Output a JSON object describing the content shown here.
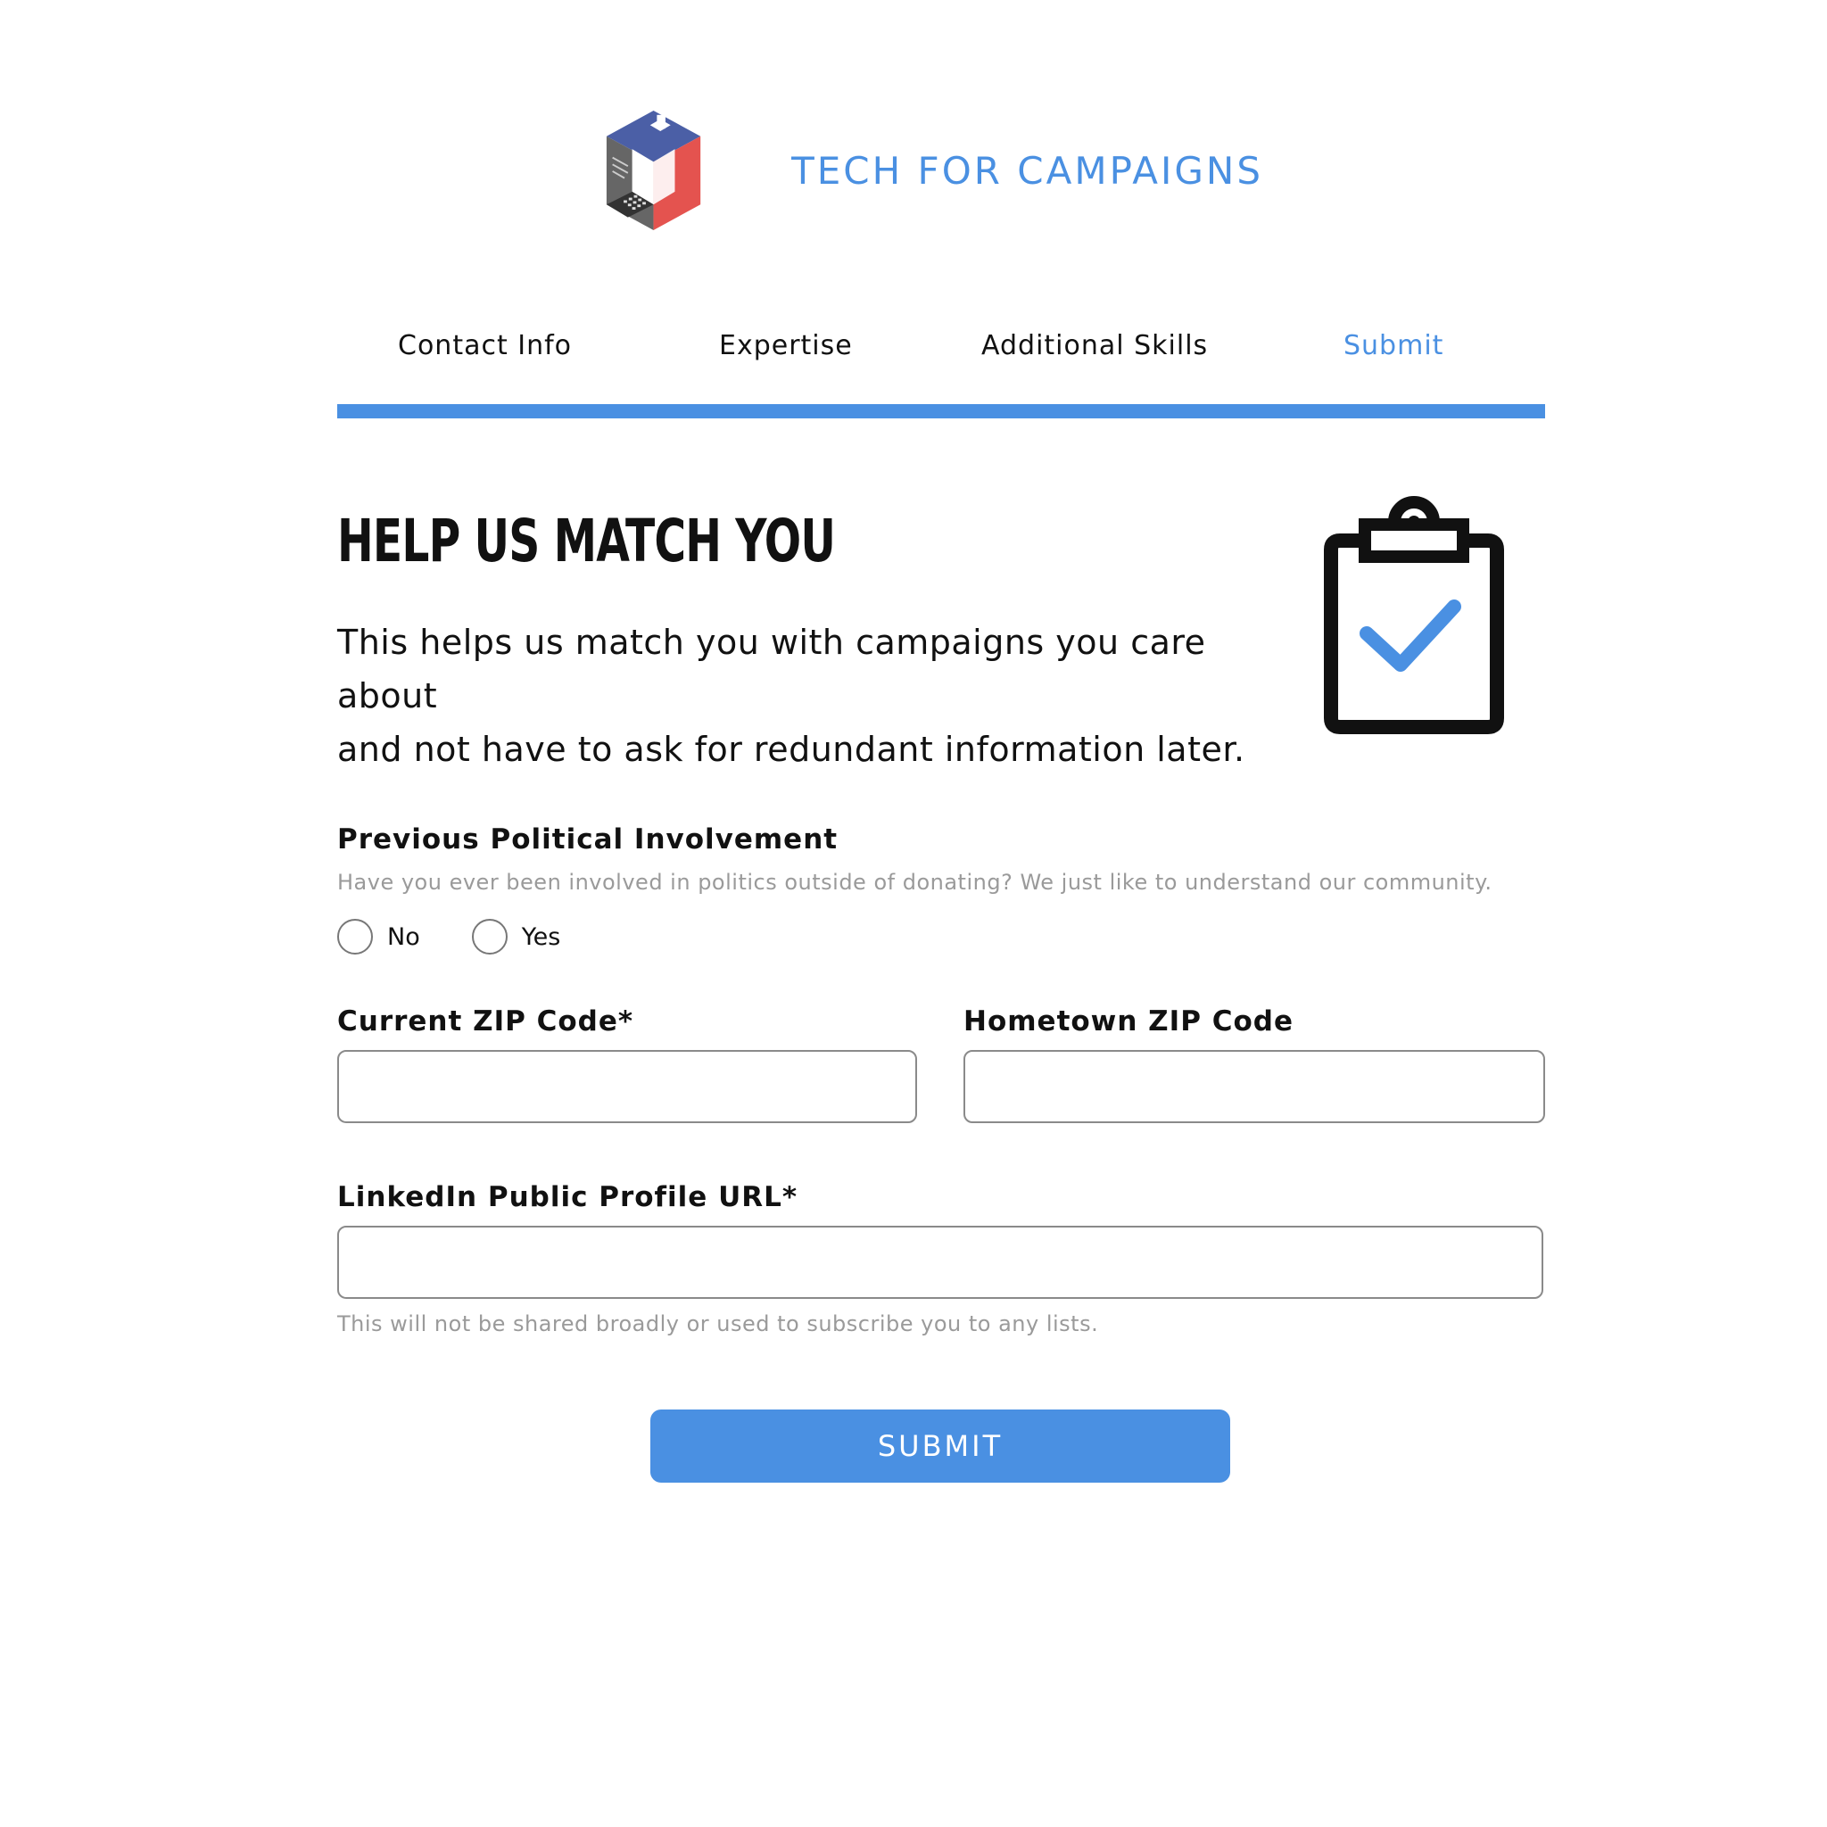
{
  "brand": {
    "name": "TECH FOR CAMPAIGNS",
    "logo_icon": "isometric-cube-laptop-logo"
  },
  "steps": [
    {
      "label": "Contact Info",
      "active": false
    },
    {
      "label": "Expertise",
      "active": false
    },
    {
      "label": "Additional Skills",
      "active": false
    },
    {
      "label": "Submit",
      "active": true
    }
  ],
  "progress": 1.0,
  "hero": {
    "title": "HELP US MATCH YOU",
    "intro_line1": "This helps us match you with campaigns you care about",
    "intro_line2": "and not have to ask for redundant information later.",
    "icon": "clipboard-check-icon"
  },
  "form": {
    "involvement": {
      "label": "Previous Political Involvement",
      "hint": "Have you ever been involved in politics outside of donating? We just like to understand our community.",
      "options": [
        "No",
        "Yes"
      ],
      "selected": null
    },
    "current_zip": {
      "label": "Current ZIP Code*",
      "value": ""
    },
    "hometown_zip": {
      "label": "Hometown ZIP Code",
      "value": ""
    },
    "linkedin": {
      "label": "LinkedIn Public Profile URL*",
      "value": "",
      "hint": "This will not be shared broadly or used to subscribe you to any lists."
    },
    "submit_label": "SUBMIT"
  },
  "colors": {
    "accent": "#4a90e2",
    "text": "#111111",
    "hint": "#9a9a9a",
    "logo_blue": "#4b5fa6",
    "logo_red": "#e4534f",
    "logo_gray": "#666666"
  }
}
